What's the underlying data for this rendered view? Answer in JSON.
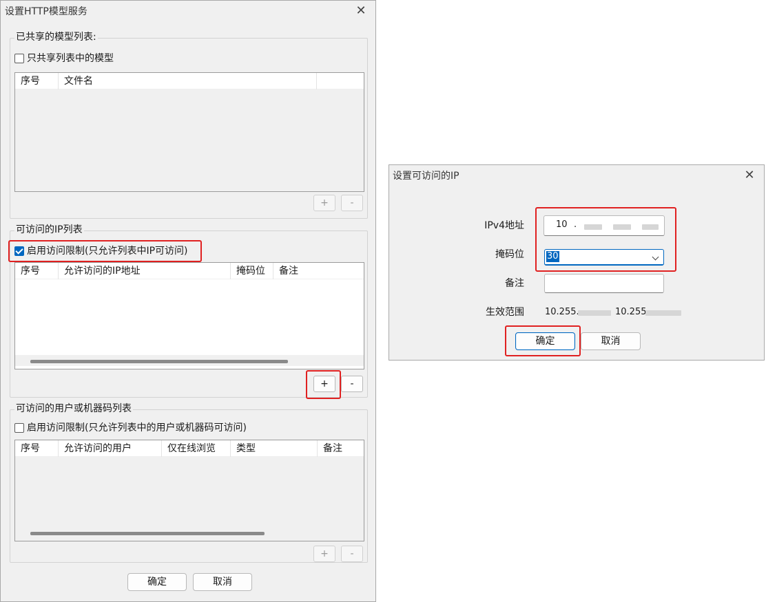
{
  "main_dialog": {
    "title": "设置HTTP模型服务",
    "model_group": {
      "legend": "已共享的模型列表:",
      "checkbox_label": "只共享列表中的模型",
      "checked": false,
      "columns": [
        "序号",
        "文件名"
      ],
      "add_label": "+",
      "remove_label": "-"
    },
    "ip_group": {
      "legend": "可访问的IP列表",
      "checkbox_label": "启用访问限制(只允许列表中IP可访问)",
      "checked": true,
      "columns": [
        "序号",
        "允许访问的IP地址",
        "掩码位",
        "备注"
      ],
      "add_label": "+",
      "remove_label": "-"
    },
    "user_group": {
      "legend": "可访问的用户或机器码列表",
      "checkbox_label": "启用访问限制(只允许列表中的用户或机器码可访问)",
      "checked": false,
      "columns": [
        "序号",
        "允许访问的用户",
        "仅在线浏览",
        "类型",
        "备注"
      ],
      "add_label": "+",
      "remove_label": "-"
    },
    "ok_label": "确定",
    "cancel_label": "取消"
  },
  "ip_dialog": {
    "title": "设置可访问的IP",
    "ipv4_label": "IPv4地址",
    "ipv4_first_octet": "10",
    "ipv4_separator": ".",
    "mask_label": "掩码位",
    "mask_value": "30",
    "note_label": "备注",
    "note_value": "",
    "range_label": "生效范围",
    "range_start": "10.255.",
    "range_end": "10.255",
    "ok_label": "确定",
    "cancel_label": "取消"
  },
  "colors": {
    "accent": "#0067c0",
    "highlight_box": "#e02020",
    "dialog_bg": "#f0f0f0"
  }
}
